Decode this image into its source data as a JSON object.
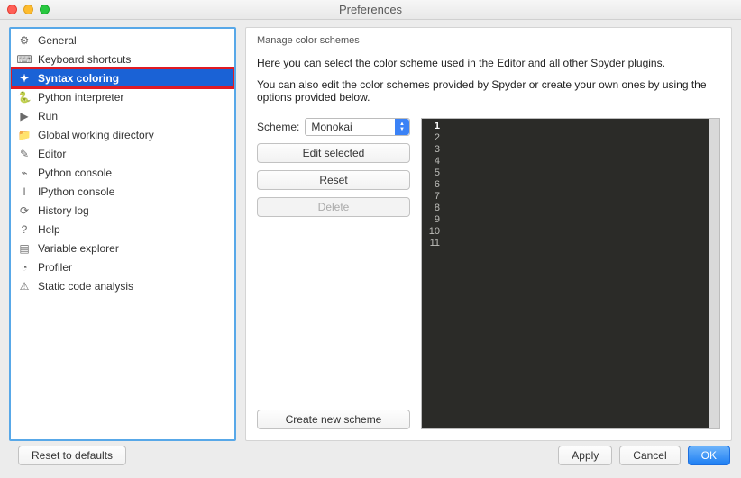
{
  "window": {
    "title": "Preferences"
  },
  "sidebar": {
    "items": [
      {
        "icon": "⚙",
        "label": "General"
      },
      {
        "icon": "⌨",
        "label": "Keyboard shortcuts"
      },
      {
        "icon": "✦",
        "label": "Syntax coloring",
        "selected": true
      },
      {
        "icon": "🐍",
        "label": "Python interpreter"
      },
      {
        "icon": "▶",
        "label": "Run"
      },
      {
        "icon": "📁",
        "label": "Global working directory"
      },
      {
        "icon": "✎",
        "label": "Editor"
      },
      {
        "icon": "⌁",
        "label": "Python console"
      },
      {
        "icon": "I",
        "label": "IPython console"
      },
      {
        "icon": "⟳",
        "label": "History log"
      },
      {
        "icon": "?",
        "label": "Help"
      },
      {
        "icon": "▤",
        "label": "Variable explorer"
      },
      {
        "icon": "◔",
        "label": "Profiler"
      },
      {
        "icon": "⚠",
        "label": "Static code analysis"
      }
    ]
  },
  "panel": {
    "group_title": "Manage color schemes",
    "desc1": "Here you can select the color scheme used in the Editor and all other Spyder plugins.",
    "desc2": "You can also edit the color schemes provided by Spyder or create your own ones by using the options provided below.",
    "scheme_label": "Scheme:",
    "scheme_value": "Monokai",
    "edit_label": "Edit selected",
    "reset_label": "Reset",
    "delete_label": "Delete",
    "create_label": "Create new scheme",
    "preview_lines": [
      "1",
      "2",
      "3",
      "4",
      "5",
      "6",
      "7",
      "8",
      "9",
      "10",
      "11"
    ]
  },
  "footer": {
    "reset_defaults": "Reset to defaults",
    "apply": "Apply",
    "cancel": "Cancel",
    "ok": "OK"
  }
}
